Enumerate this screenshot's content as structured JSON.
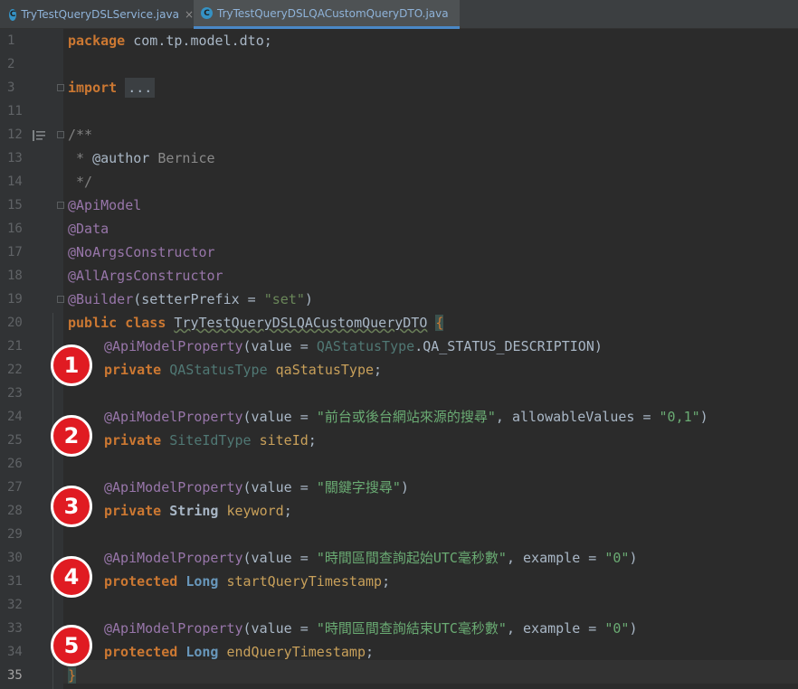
{
  "tabs": [
    {
      "label": "TryTestQueryDSLService.java",
      "icon": "class-icon",
      "close": "×"
    },
    {
      "label": "TryTestQueryDSLQACustomQueryDTO.java",
      "icon": "class-icon"
    }
  ],
  "lines": {
    "n1": "1",
    "n2": "2",
    "n3": "3",
    "n11": "11",
    "n12": "12",
    "n13": "13",
    "n14": "14",
    "n15": "15",
    "n16": "16",
    "n17": "17",
    "n18": "18",
    "n19": "19",
    "n20": "20",
    "n21": "21",
    "n22": "22",
    "n23": "23",
    "n24": "24",
    "n25": "25",
    "n26": "26",
    "n27": "27",
    "n28": "28",
    "n29": "29",
    "n30": "30",
    "n31": "31",
    "n32": "32",
    "n33": "33",
    "n34": "34",
    "n35": "35"
  },
  "code": {
    "l1_kw": "package",
    "l1_pkg": " com.tp.model.dto;",
    "l3_kw": "import",
    "l3_folded": "...",
    "l12": "/**",
    "l13_star": " * ",
    "l13_tag": "@author",
    "l13_val": " Bernice",
    "l14": " */",
    "l15": "@ApiModel",
    "l16": "@Data",
    "l17": "@NoArgsConstructor",
    "l18": "@AllArgsConstructor",
    "l19_ann": "@Builder",
    "l19_a": "(setterPrefix = ",
    "l19_str": "\"set\"",
    "l19_b": ")",
    "l20_kw": "public class ",
    "l20_cls": "TryTestQueryDSLQACustomQueryDTO",
    "l20_brace": "{",
    "l21_ann": "@ApiModelProperty",
    "l21_a": "(value = ",
    "l21_typ": "QAStatusType",
    "l21_b": ".QA_STATUS_DESCRIPTION)",
    "l22_kw": "private ",
    "l22_typ": "QAStatusType ",
    "l22_field": "qaStatusType",
    "l22_end": ";",
    "l24_ann": "@ApiModelProperty",
    "l24_a": "(value = ",
    "l24_str": "\"前台或後台網站來源的搜尋\"",
    "l24_b": ", allowableValues = ",
    "l24_str2": "\"0,1\"",
    "l24_c": ")",
    "l25_kw": "private ",
    "l25_typ": "SiteIdType ",
    "l25_field": "siteId",
    "l25_end": ";",
    "l27_ann": "@ApiModelProperty",
    "l27_a": "(value = ",
    "l27_str": "\"關鍵字搜尋\"",
    "l27_b": ")",
    "l28_kw": "private ",
    "l28_typ": "String ",
    "l28_field": "keyword",
    "l28_end": ";",
    "l30_ann": "@ApiModelProperty",
    "l30_a": "(value = ",
    "l30_str": "\"時間區間查詢起始UTC毫秒數\"",
    "l30_b": ", example = ",
    "l30_str2": "\"0\"",
    "l30_c": ")",
    "l31_kw": "protected ",
    "l31_typ": "Long ",
    "l31_field": "startQueryTimestamp",
    "l31_end": ";",
    "l33_ann": "@ApiModelProperty",
    "l33_a": "(value = ",
    "l33_str": "\"時間區間查詢結束UTC毫秒數\"",
    "l33_b": ", example = ",
    "l33_str2": "\"0\"",
    "l33_c": ")",
    "l34_kw": "protected ",
    "l34_typ": "Long ",
    "l34_field": "endQueryTimestamp",
    "l34_end": ";",
    "l35": "}"
  },
  "badges": [
    "1",
    "2",
    "3",
    "4",
    "5"
  ],
  "colors": {
    "background": "#2b2b2b",
    "keyword": "#cc7832",
    "string": "#6a8759",
    "annotation": "#bbb529",
    "field": "#9876aa",
    "badge": "#e01b22"
  }
}
